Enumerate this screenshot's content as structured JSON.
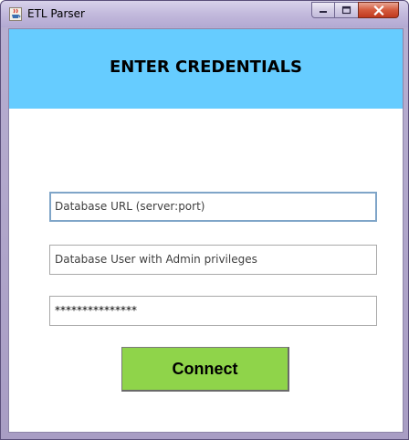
{
  "window": {
    "title": "ETL Parser",
    "app_icon": "java-cup-icon",
    "controls": {
      "minimize_icon": "minimize-icon",
      "maximize_icon": "maximize-icon",
      "close_icon": "close-icon"
    }
  },
  "header": {
    "title": "ENTER CREDENTIALS",
    "background": "#66ccff"
  },
  "form": {
    "url_field": {
      "value": "Database URL (server:port)"
    },
    "user_field": {
      "value": "Database User with Admin privileges"
    },
    "password_field": {
      "value": "***************"
    },
    "connect_label": "Connect",
    "connect_color": "#8fd44a"
  }
}
